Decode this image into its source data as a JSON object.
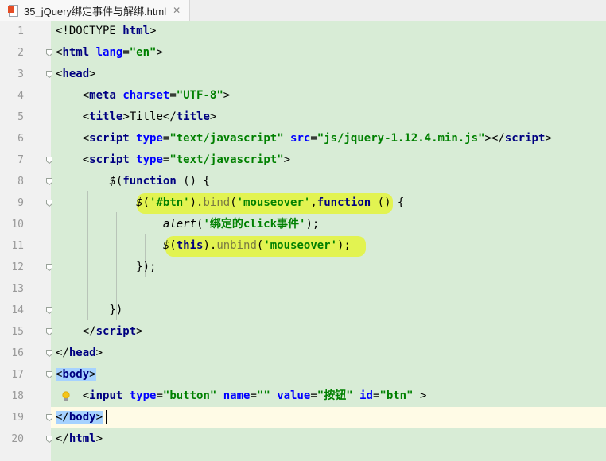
{
  "tab": {
    "title": "35_jQuery绑定事件与解绑.html",
    "close_glyph": "✕"
  },
  "line_numbers": [
    "1",
    "2",
    "3",
    "4",
    "5",
    "6",
    "7",
    "8",
    "9",
    "10",
    "11",
    "12",
    "13",
    "14",
    "15",
    "16",
    "17",
    "18",
    "19",
    "20"
  ],
  "lines": [
    [
      {
        "t": "<!DOCTYPE ",
        "c": "pl"
      },
      {
        "t": "html",
        "c": "tag"
      },
      {
        "t": ">",
        "c": "pl"
      }
    ],
    [
      {
        "t": "<",
        "c": "pl"
      },
      {
        "t": "html ",
        "c": "tag"
      },
      {
        "t": "lang",
        "c": "attr"
      },
      {
        "t": "=",
        "c": "pl"
      },
      {
        "t": "\"en\"",
        "c": "str"
      },
      {
        "t": ">",
        "c": "pl"
      }
    ],
    [
      {
        "t": "<",
        "c": "pl"
      },
      {
        "t": "head",
        "c": "tag"
      },
      {
        "t": ">",
        "c": "pl"
      }
    ],
    [
      {
        "t": "    <",
        "c": "pl"
      },
      {
        "t": "meta ",
        "c": "tag"
      },
      {
        "t": "charset",
        "c": "attr"
      },
      {
        "t": "=",
        "c": "pl"
      },
      {
        "t": "\"UTF-8\"",
        "c": "str"
      },
      {
        "t": ">",
        "c": "pl"
      }
    ],
    [
      {
        "t": "    <",
        "c": "pl"
      },
      {
        "t": "title",
        "c": "tag"
      },
      {
        "t": ">Title</",
        "c": "pl"
      },
      {
        "t": "title",
        "c": "tag"
      },
      {
        "t": ">",
        "c": "pl"
      }
    ],
    [
      {
        "t": "    <",
        "c": "pl"
      },
      {
        "t": "script ",
        "c": "tag"
      },
      {
        "t": "type",
        "c": "attr"
      },
      {
        "t": "=",
        "c": "pl"
      },
      {
        "t": "\"text/javascript\" ",
        "c": "str"
      },
      {
        "t": "src",
        "c": "attr"
      },
      {
        "t": "=",
        "c": "pl"
      },
      {
        "t": "\"js/jquery-1.12.4.min.js\"",
        "c": "str"
      },
      {
        "t": "></",
        "c": "pl"
      },
      {
        "t": "script",
        "c": "tag"
      },
      {
        "t": ">",
        "c": "pl"
      }
    ],
    [
      {
        "t": "    <",
        "c": "pl"
      },
      {
        "t": "script ",
        "c": "tag"
      },
      {
        "t": "type",
        "c": "attr"
      },
      {
        "t": "=",
        "c": "pl"
      },
      {
        "t": "\"text/javascript\"",
        "c": "str"
      },
      {
        "t": ">",
        "c": "pl"
      }
    ],
    [
      {
        "t": "        ",
        "c": "pl"
      },
      {
        "t": "$",
        "c": "it"
      },
      {
        "t": "(",
        "c": "pl"
      },
      {
        "t": "function",
        "c": "kw"
      },
      {
        "t": " () {",
        "c": "pl"
      }
    ],
    [
      {
        "t": "            ",
        "c": "pl"
      },
      {
        "t": "$",
        "c": "it"
      },
      {
        "t": "(",
        "c": "pl"
      },
      {
        "t": "'#btn'",
        "c": "str"
      },
      {
        "t": ").",
        "c": "pl"
      },
      {
        "t": "bind",
        "c": "fn"
      },
      {
        "t": "(",
        "c": "pl"
      },
      {
        "t": "'mouseover'",
        "c": "str"
      },
      {
        "t": ",",
        "c": "pl"
      },
      {
        "t": "function",
        "c": "kw"
      },
      {
        "t": " () {",
        "c": "pl"
      }
    ],
    [
      {
        "t": "                ",
        "c": "pl"
      },
      {
        "t": "alert",
        "c": "it"
      },
      {
        "t": "(",
        "c": "pl"
      },
      {
        "t": "'绑定的click事件'",
        "c": "str"
      },
      {
        "t": ");",
        "c": "pl"
      }
    ],
    [
      {
        "t": "                ",
        "c": "pl"
      },
      {
        "t": "$",
        "c": "it"
      },
      {
        "t": "(",
        "c": "pl"
      },
      {
        "t": "this",
        "c": "kw"
      },
      {
        "t": ").",
        "c": "pl"
      },
      {
        "t": "unbind",
        "c": "fn"
      },
      {
        "t": "(",
        "c": "pl"
      },
      {
        "t": "'mouseover'",
        "c": "str"
      },
      {
        "t": ");",
        "c": "pl"
      }
    ],
    [
      {
        "t": "            });",
        "c": "pl"
      }
    ],
    [
      {
        "t": "",
        "c": "pl"
      }
    ],
    [
      {
        "t": "        })",
        "c": "pl"
      }
    ],
    [
      {
        "t": "    </",
        "c": "pl"
      },
      {
        "t": "script",
        "c": "tag"
      },
      {
        "t": ">",
        "c": "pl"
      }
    ],
    [
      {
        "t": "</",
        "c": "pl"
      },
      {
        "t": "head",
        "c": "tag"
      },
      {
        "t": ">",
        "c": "pl"
      }
    ],
    [
      {
        "t": "<",
        "c": "pl"
      },
      {
        "t": "body",
        "c": "tag"
      },
      {
        "t": ">",
        "c": "pl"
      }
    ],
    [
      {
        "t": "    <",
        "c": "pl"
      },
      {
        "t": "input ",
        "c": "tag"
      },
      {
        "t": "type",
        "c": "attr"
      },
      {
        "t": "=",
        "c": "pl"
      },
      {
        "t": "\"button\" ",
        "c": "str"
      },
      {
        "t": "name",
        "c": "attr"
      },
      {
        "t": "=",
        "c": "pl"
      },
      {
        "t": "\"\" ",
        "c": "str"
      },
      {
        "t": "value",
        "c": "attr"
      },
      {
        "t": "=",
        "c": "pl"
      },
      {
        "t": "\"按钮\" ",
        "c": "str"
      },
      {
        "t": "id",
        "c": "attr"
      },
      {
        "t": "=",
        "c": "pl"
      },
      {
        "t": "\"btn\"",
        "c": "str"
      },
      {
        "t": " >",
        "c": "pl"
      }
    ],
    [
      {
        "t": "</",
        "c": "pl"
      },
      {
        "t": "body",
        "c": "tag"
      },
      {
        "t": ">",
        "c": "pl"
      }
    ],
    [
      {
        "t": "</",
        "c": "pl"
      },
      {
        "t": "html",
        "c": "tag"
      },
      {
        "t": ">",
        "c": "pl"
      }
    ]
  ],
  "colors": {
    "code_background": "#d8ecd6",
    "gutter": "#f1f1f1",
    "caret_line": "#fffbe6",
    "marker_highlight": "#e4f43a",
    "selection": "#a6d2ff"
  },
  "icons": {
    "file_icon": "html5-file-icon",
    "intention_icon": "lightbulb-icon"
  }
}
